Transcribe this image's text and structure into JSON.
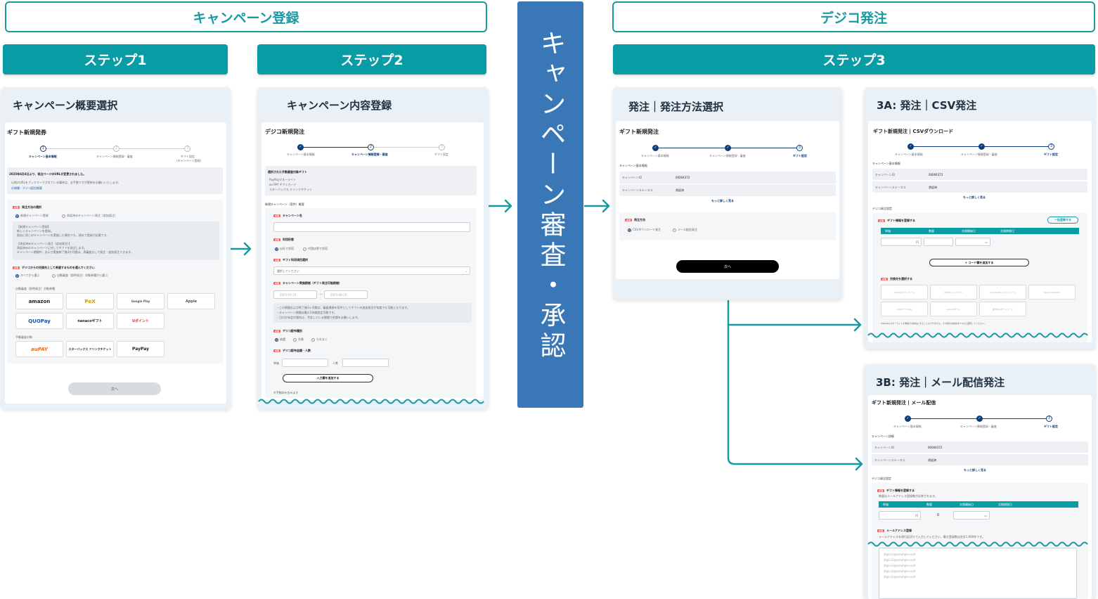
{
  "headers": {
    "campaign_registration": "キャンペーン登録",
    "digico_order": "デジコ発注",
    "step1": "ステップ1",
    "step2": "ステップ2",
    "step3": "ステップ3",
    "review": "キャンペーン審査・承認"
  },
  "panel1": {
    "title": "キャンペーン概要選択",
    "card_title": "ギフト新規発券",
    "progress": [
      "キャンペーン基本情報",
      "キャンペーン情報登録・審査",
      "ギフト設定"
    ],
    "progress_sub": "(キャンペーン登録)",
    "notice_title": "2025年6月4日より、発注ページのURLが変更されました。",
    "notice_lines": [
      "以前のURLをブックマークされている場合は、お手数ですが更新をお願いいたします。",
      "仕様書：デジコ配信概要"
    ],
    "q1_label": "発注方法の選択",
    "q1_options": [
      "新規キャンペーン登録",
      "承認済みキャンペーン発注（追加発注）"
    ],
    "q1_desc_title1": "【新規キャンペーン登録】",
    "q1_desc1": [
      "新しくキャンペーンを登録。",
      "過去に同じのキャンペーンを実施した場合でも、改めて登録が必要です。"
    ],
    "q1_desc_title2": "【承認済みキャンペーン発注（追加発注）】",
    "q1_desc2": [
      "承認済みのキャンペーンに対してギフトを発注します。",
      "キャンペーン期間中、および実施終了後3か月間は、再審査なしで発注・追加発注できます。"
    ],
    "q2_label": "デジコからの交換先として希望するものを選んでください",
    "q2_options": [
      "すべてから選ぶ",
      "自動審査（即時発注）対象券種から選ぶ"
    ],
    "group_auto": "自動審査（即時発注）対象券種",
    "group_manual": "手動審査対象",
    "tiles_auto": [
      "amazon",
      "PeX",
      "Google Play",
      "Apple",
      "QUOPay",
      "nanacoギフト",
      "Uポイント"
    ],
    "tiles_manual": [
      "auPAY",
      "スターバックス ドリンクチケット",
      "PayPay"
    ],
    "next_button": "次へ"
  },
  "panel2": {
    "title": "キャンペーン内容登録",
    "card_title": "デジコ新規発注",
    "progress": [
      "キャンペーン基本情報",
      "キャンペーン情報登録・審査",
      "ギフト設定"
    ],
    "selected_title": "選択された手動審査対象ギフト",
    "selected_items": [
      "PayPayマネーライト",
      "au PAY ギフトカード",
      "スターバックス ドリンクチケット"
    ],
    "section": "新規キャンペーン（案件）概要",
    "f_name": "キャンペーン名",
    "f_usage": "利用形態",
    "f_usage_opts": [
      "自社で利用",
      "代理店等で利用"
    ],
    "f_gift_type": "ギフト利用項目選択",
    "f_gift_type_placeholder": "選択してください",
    "f_period": "キャンペーン実施期間（ギフト発注可能期間）",
    "f_period_from": "2025-07-10",
    "f_period_to": "2025-08-10",
    "f_period_notes": [
      "・この期間および終了後3ヶ月間は、審査通過を条件としてギフトの追加発注が何度でも可能となります。",
      "・キャンペーン期間は最大1年間設定可能です。",
      "・日付が未定の場合は、予定している期間で申請をお願いします。"
    ],
    "f_dist": "デジコ配布種別",
    "f_dist_opts": [
      "抽選",
      "先着",
      "もれなく"
    ],
    "f_amount": "デジコ配布金額・人数",
    "f_amount_unit": "単価",
    "f_amount_people": "人数",
    "add_button": "入力欄を追加する",
    "footer_note": "※手数料を含みます"
  },
  "panel3": {
    "title": "発注｜発注方法選択",
    "card_title": "ギフト新規発注",
    "progress": [
      "キャンペーン基本情報",
      "キャンペーン情報登録・審査",
      "ギフト設定"
    ],
    "basic_info": "キャンペーン基本情報",
    "rows": [
      [
        "キャンペーンID",
        "00004372"
      ],
      [
        "キャンペーンステータス",
        "承認済"
      ]
    ],
    "more": "もっと詳しく見る",
    "method_label": "発注方法",
    "method_opts": [
      "CSVダウンロード発注",
      "メール配信発注"
    ],
    "next_button": "次へ"
  },
  "panel3a": {
    "title": "3A: 発注｜CSV発注",
    "card_title": "ギフト新規発注 | CSVダウンロード",
    "progress": [
      "キャンペーン基本情報",
      "キャンペーン情報登録・審査",
      "ギフト設定"
    ],
    "basic_info": "キャンペーン基本情報",
    "rows": [
      [
        "キャンペーンID",
        "00004372"
      ],
      [
        "キャンペーンステータス",
        "承認済"
      ]
    ],
    "more": "もっと詳しく見る",
    "order_settings": "デジコ発注設定",
    "gift_info": "ギフト情報を登録する",
    "bulk_button": "一括登録する",
    "table_headers": [
      "単価",
      "数量",
      "交換開始日",
      "交換期限日"
    ],
    "unit": "円",
    "add_code": "+ コード欄を追加する",
    "exchange_label": "交換先を選択する",
    "exchange_tiles": [
      "Amazonギフトカード",
      "PeXポイントギフト",
      "Google Play ギフトコード",
      "Apple Gift Card",
      "QUOカードPay",
      "nanacoギフト",
      "楽天Edyギフトコード"
    ],
    "note": "※PayPayマネーライトを単独で交換先にすることはできません。その他の交換先を1つ以上選択してください。"
  },
  "panel3b": {
    "title": "3B: 発注｜メール配信発注",
    "card_title": "ギフト新規発注 | メール配信",
    "progress": [
      "キャンペーン基本情報",
      "キャンペーン情報登録・審査",
      "ギフト設定"
    ],
    "basic_info": "キャンペーン詳細",
    "rows": [
      [
        "キャンペーンID",
        "00004372"
      ],
      [
        "キャンペーンステータス",
        "承認済"
      ]
    ],
    "more": "もっと詳しく見る",
    "order_settings": "デジコ発注設定",
    "gift_info": "ギフト情報を登録する",
    "gift_info_note": "数量はメールアドレス登録数が反映されます。",
    "table_headers": [
      "単価",
      "数量",
      "交換開始日",
      "交換期限日"
    ],
    "unit": "円",
    "qty": "0",
    "email_label": "メールアドレス登録",
    "email_note": "メールアドレスを改行区切りで入力してください。最大登録数は合計1,000件です。",
    "emails": [
      "digico1@example.com",
      "digico2@example.com",
      "digico3@example.com",
      "digico4@example.com",
      "digico5@example.com"
    ]
  },
  "colors": {
    "teal": "#0a9ca4",
    "blue": "#3a77b7",
    "navy": "#0d3d7a",
    "required": "#f0605d"
  }
}
